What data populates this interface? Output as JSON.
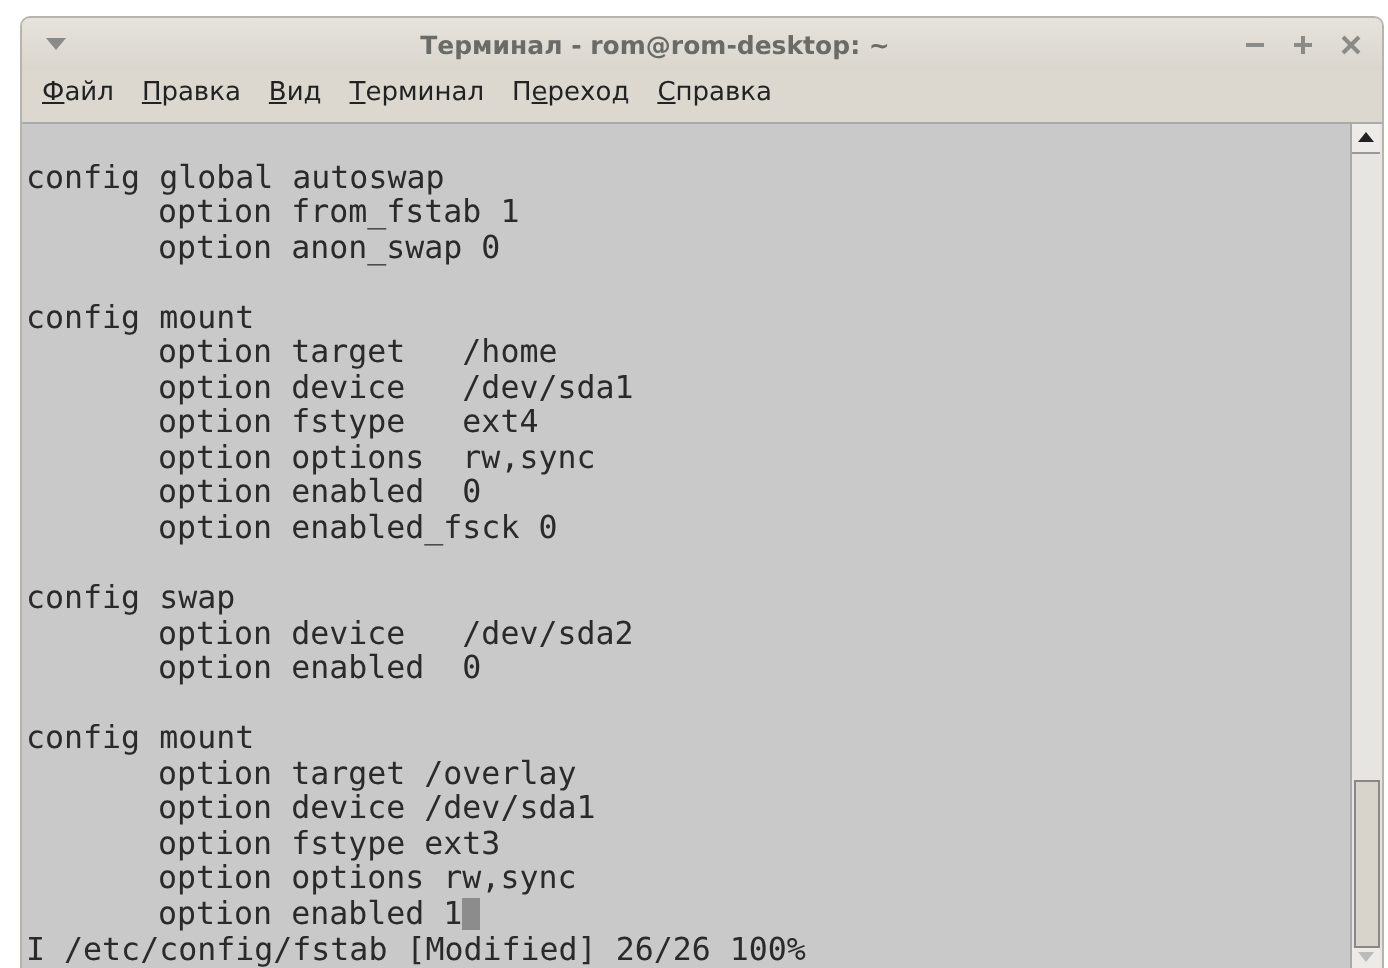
{
  "window": {
    "title": "Терминал - rom@rom-desktop: ~"
  },
  "menu": [
    {
      "label": "Файл",
      "mnemonic_on_second_letter": false
    },
    {
      "label": "Правка",
      "mnemonic_on_second_letter": false
    },
    {
      "label": "Вид",
      "mnemonic_on_second_letter": false
    },
    {
      "label": "Терминал",
      "mnemonic_on_second_letter": false
    },
    {
      "label": "Переход",
      "mnemonic_on_second_letter": true
    },
    {
      "label": "Справка",
      "mnemonic_on_second_letter": false
    }
  ],
  "terminal": {
    "blocks": [
      {
        "header": "config global autoswap",
        "options": [
          "option from_fstab 1",
          "option anon_swap 0"
        ]
      },
      {
        "header": "config mount",
        "options": [
          "option target   /home",
          "option device   /dev/sda1",
          "option fstype   ext4",
          "option options  rw,sync",
          "option enabled  0",
          "option enabled_fsck 0"
        ]
      },
      {
        "header": "config swap",
        "options": [
          "option device   /dev/sda2",
          "option enabled  0"
        ]
      },
      {
        "header": "config mount",
        "options": [
          "option target /overlay",
          "option device /dev/sda1",
          "option fstype ext3",
          "option options rw,sync",
          "option enabled 1"
        ]
      }
    ],
    "cursor_visible": true,
    "status_line": "I /etc/config/fstab [Modified] 26/26 100%"
  }
}
